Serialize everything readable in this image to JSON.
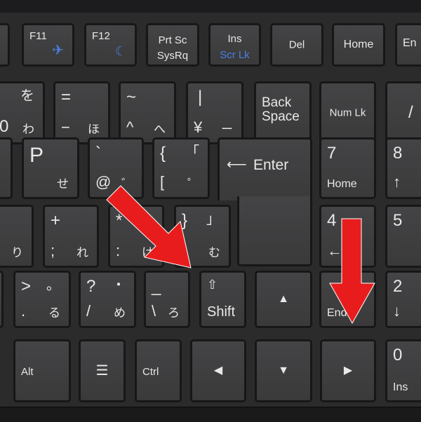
{
  "colors": {
    "arrow": "#e81c1c",
    "key": "#3f3f40",
    "label": "#e8e8e8",
    "function_label": "#4a7fe0"
  },
  "row1": {
    "f11": "F11",
    "f11_fn_icon": "airplane-icon",
    "f12": "F12",
    "f12_fn_icon": "moon-icon",
    "prtsc": "Prt Sc",
    "sysrq": "SysRq",
    "ins": "Ins",
    "scrlk": "Scr Lk",
    "del": "Del",
    "home": "Home",
    "end_partial": "En"
  },
  "row2": {
    "k0": "0",
    "wo": "を",
    "wa": "わ",
    "eq": "=",
    "minus": "−",
    "ho": "ほ",
    "tilde": "~",
    "caret": "^",
    "he": "へ",
    "pipe": "|",
    "yen": "¥",
    "chouon": "ー",
    "back": "Back",
    "space": "Space",
    "numlk": "Num Lk",
    "slash": "/"
  },
  "row3": {
    "p": "P",
    "se": "せ",
    "backtick": "`",
    "at": "@",
    "dakuten": "゛",
    "lbrace": "{",
    "lbracket": "[",
    "kakko": "「",
    "handakuten": "゜",
    "enter": "Enter",
    "seven": "7",
    "home": "Home",
    "eight": "8"
  },
  "row4": {
    "ri": "り",
    "plus": "+",
    "semicolon": ";",
    "re": "れ",
    "star": "*",
    "colon": ":",
    "ke": "け",
    "rbrace": "}",
    "kakko_close": "」",
    "mu": "む",
    "four": "4",
    "five": "5"
  },
  "row5": {
    "gt": ">",
    "period": ".",
    "maru": "。",
    "ru": "る",
    "question": "?",
    "slash": "/",
    "nakaguro": "・",
    "me": "め",
    "underscore": "_",
    "backslash": "\\",
    "ro": "ろ",
    "shift": "Shift",
    "end": "End",
    "two": "2"
  },
  "row6": {
    "alt": "Alt",
    "menu_icon": "menu-icon",
    "ctrl": "Ctrl",
    "zero": "0",
    "ins": "Ins"
  },
  "arrows": [
    "pointing to Shift key",
    "pointing to End key"
  ]
}
